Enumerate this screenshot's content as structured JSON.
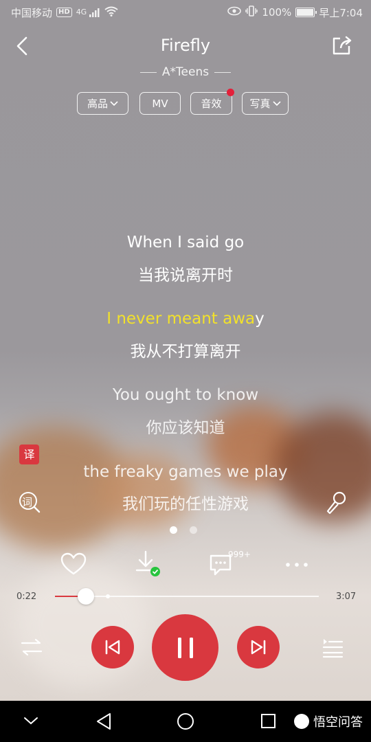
{
  "status_bar": {
    "carrier": "中国移动",
    "hd": "HD",
    "network": "4G",
    "battery": "100%",
    "time": "早上7:04"
  },
  "header": {
    "title": "Firefly",
    "artist": "A*Teens"
  },
  "chips": [
    {
      "label": "高品",
      "has_dropdown": true
    },
    {
      "label": "MV",
      "has_dropdown": false
    },
    {
      "label": "音效",
      "has_dropdown": false,
      "badge": true
    },
    {
      "label": "写真",
      "has_dropdown": true
    }
  ],
  "lyrics": [
    {
      "en": "When I said go",
      "zh": "当我说离开时"
    },
    {
      "en_sung": "I never meant awa",
      "en_rest": "y",
      "zh": "我从不打算离开",
      "active": true
    },
    {
      "en": "You ought to know",
      "zh": "你应该知道"
    },
    {
      "en": "the freaky games we play",
      "zh": "我们玩的任性游戏"
    }
  ],
  "side_badges": {
    "translate": "译",
    "lyrics_icon": "词"
  },
  "actions": {
    "comment_count": "999+"
  },
  "progress": {
    "current": "0:22",
    "total": "3:07",
    "fraction": 0.118,
    "buffered_fraction": 0.2
  },
  "pager": {
    "active_index": 0,
    "count": 2
  },
  "icons": {
    "back": "chevron-left-icon",
    "share": "share-icon",
    "favorite": "heart-icon",
    "download": "download-icon",
    "comment": "comment-icon",
    "more": "more-icon",
    "mic": "microphone-icon",
    "shuffle": "shuffle-icon",
    "prev": "skip-previous-icon",
    "pause": "pause-icon",
    "next": "skip-next-icon",
    "playlist": "playlist-icon"
  },
  "colors": {
    "accent": "#d9383f",
    "active_lyric": "#f2e12b"
  },
  "watermark": "悟空问答"
}
